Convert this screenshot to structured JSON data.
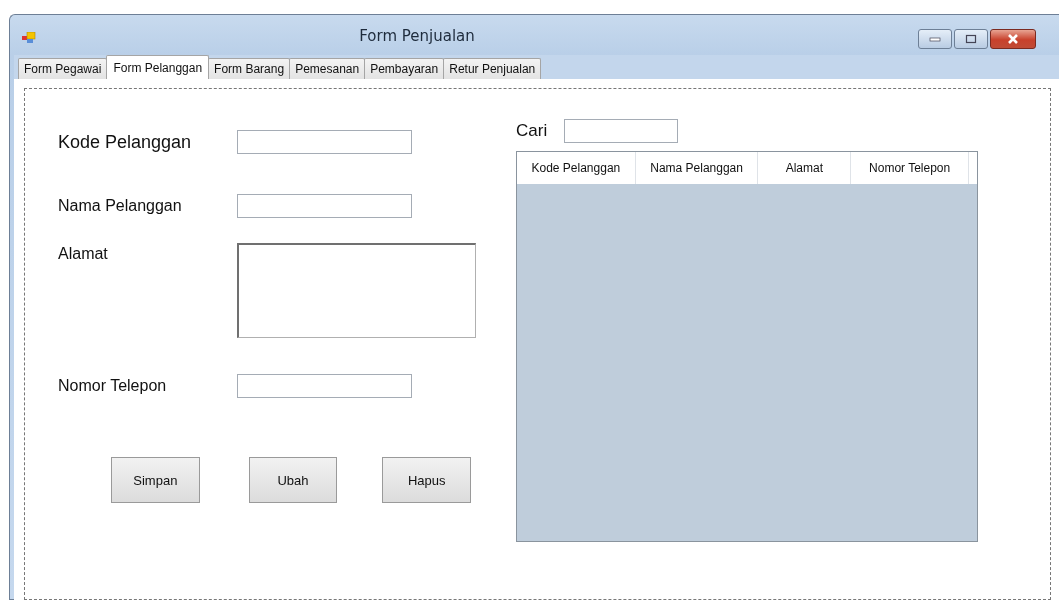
{
  "window": {
    "title": "Form Penjualan"
  },
  "tabs": [
    {
      "label": "Form Pegawai",
      "selected": false
    },
    {
      "label": "Form Pelanggan",
      "selected": true
    },
    {
      "label": "Form Barang",
      "selected": false
    },
    {
      "label": "Pemesanan",
      "selected": false
    },
    {
      "label": "Pembayaran",
      "selected": false
    },
    {
      "label": "Retur Penjualan",
      "selected": false
    }
  ],
  "form": {
    "fields": [
      {
        "label": "Kode Pelanggan",
        "kind": "text",
        "large": true
      },
      {
        "label": "Nama Pelanggan",
        "kind": "text",
        "large": false
      },
      {
        "label": "Alamat",
        "kind": "multiline",
        "large": false
      },
      {
        "label": "Nomor Telepon",
        "kind": "text",
        "large": false
      }
    ],
    "buttons": [
      "Simpan",
      "Ubah",
      "Hapus"
    ]
  },
  "search": {
    "label": "Cari"
  },
  "table": {
    "columns": [
      "Kode Pelanggan",
      "Nama Pelanggan",
      "Alamat",
      "Nomor Telepon"
    ]
  }
}
